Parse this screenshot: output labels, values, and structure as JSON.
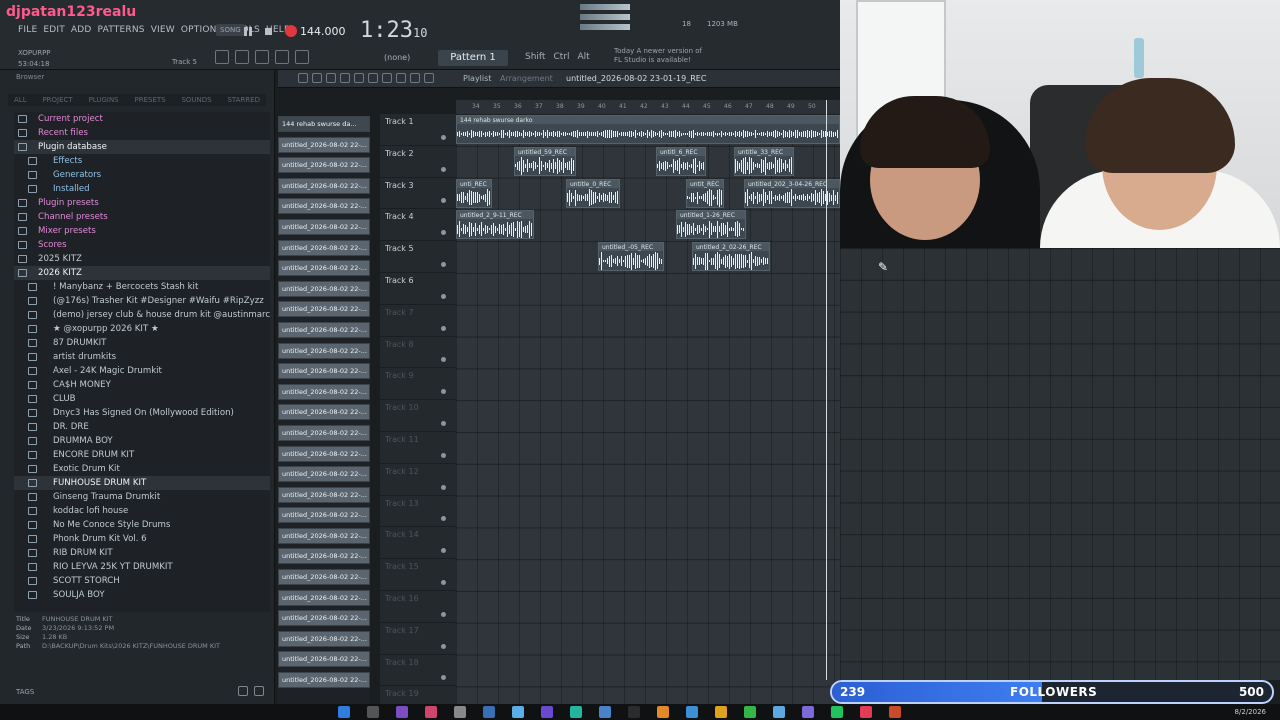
{
  "stream": {
    "username": "djpatan123realu"
  },
  "menu": [
    "FILE",
    "EDIT",
    "ADD",
    "PATTERNS",
    "VIEW",
    "OPTIONS",
    "TOOLS",
    "HELP"
  ],
  "transport": {
    "song_label": "SONG",
    "tempo": "144.000",
    "time": "1:23",
    "time_sub": "10",
    "cpu": "18",
    "ram": "1203 MB"
  },
  "user_tag": {
    "name": "XOPURPP",
    "elapsed": "53:04:18",
    "track": "Track 5"
  },
  "pattern": "Pattern 1",
  "snap": "(none)",
  "keys": [
    "Shift",
    "Ctrl",
    "Alt"
  ],
  "news": [
    "Today  A newer version of",
    "FL Studio is available!"
  ],
  "browser": {
    "title": "Browser",
    "tabs": [
      "ALL",
      "PROJECT",
      "PLUGINS",
      "PRESETS",
      "SOUNDS",
      "STARRED"
    ],
    "items": [
      {
        "label": "Current project",
        "kind": "pink"
      },
      {
        "label": "Recent files",
        "kind": "pink"
      },
      {
        "label": "Plugin database",
        "kind": "blue",
        "selected": true
      },
      {
        "label": "Effects",
        "kind": "blue",
        "level": 2
      },
      {
        "label": "Generators",
        "kind": "blue",
        "level": 2
      },
      {
        "label": "Installed",
        "kind": "blue",
        "level": 2
      },
      {
        "label": "Plugin presets",
        "kind": "pink"
      },
      {
        "label": "Channel presets",
        "kind": "pink"
      },
      {
        "label": "Mixer presets",
        "kind": "pink"
      },
      {
        "label": "Scores",
        "kind": "pink"
      },
      {
        "label": "2025 KITZ",
        "kind": "normal"
      },
      {
        "label": "2026 KITZ",
        "kind": "normal",
        "selected": true
      },
      {
        "label": "! Manybanz + Bercocets Stash kit",
        "kind": "normal",
        "level": 2
      },
      {
        "label": "(@176s) Trasher Kit #Designer #Waifu #RipZyzz",
        "kind": "normal",
        "level": 2
      },
      {
        "label": "(demo) jersey club & house drum kit @austinmarc",
        "kind": "normal",
        "level": 2
      },
      {
        "label": "★ @xopurpp 2026 KIT ★",
        "kind": "normal",
        "level": 2
      },
      {
        "label": "87 DRUMKIT",
        "kind": "normal",
        "level": 2
      },
      {
        "label": "artist drumkits",
        "kind": "normal",
        "level": 2
      },
      {
        "label": "Axel - 24K Magic Drumkit",
        "kind": "normal",
        "level": 2
      },
      {
        "label": "CA$H MONEY",
        "kind": "normal",
        "level": 2
      },
      {
        "label": "CLUB",
        "kind": "normal",
        "level": 2
      },
      {
        "label": "Dnyc3 Has Signed On (Mollywood Edition)",
        "kind": "normal",
        "level": 2
      },
      {
        "label": "DR. DRE",
        "kind": "normal",
        "level": 2
      },
      {
        "label": "DRUMMA BOY",
        "kind": "normal",
        "level": 2
      },
      {
        "label": "ENCORE DRUM KIT",
        "kind": "normal",
        "level": 2
      },
      {
        "label": "Exotic Drum Kit",
        "kind": "normal",
        "level": 2
      },
      {
        "label": "FUNHOUSE DRUM KIT",
        "kind": "normal",
        "level": 2,
        "selected": true
      },
      {
        "label": "Ginseng Trauma Drumkit",
        "kind": "normal",
        "level": 2
      },
      {
        "label": "koddac lofi house",
        "kind": "normal",
        "level": 2
      },
      {
        "label": "No Me Conoce Style Drums",
        "kind": "normal",
        "level": 2
      },
      {
        "label": "Phonk Drum Kit Vol. 6",
        "kind": "normal",
        "level": 2
      },
      {
        "label": "RIB DRUM KIT",
        "kind": "normal",
        "level": 2
      },
      {
        "label": "RIO LEYVA 25K YT DRUMKIT",
        "kind": "normal",
        "level": 2
      },
      {
        "label": "SCOTT STORCH",
        "kind": "normal",
        "level": 2
      },
      {
        "label": "SOULJA BOY",
        "kind": "normal",
        "level": 2
      }
    ],
    "info": {
      "title": "FUNHOUSE DRUM KIT",
      "date": "3/23/2026 9:13:52 PM",
      "size": "1.28 KB",
      "path": "D:\\BACKUP\\Drum Kits\\2026 KITZ\\FUNHOUSE DRUM KIT"
    },
    "tags_label": "TAGS"
  },
  "channels": [
    "144 rehab swurse da...",
    "untitled_2026-08-02 22-...",
    "untitled_2026-08-02 22-...",
    "untitled_2026-08-02 22-...",
    "untitled_2026-08-02 22-...",
    "untitled_2026-08-02 22-...",
    "untitled_2026-08-02 22-...",
    "untitled_2026-08-02 22-...",
    "untitled_2026-08-02 22-...",
    "untitled_2026-08-02 22-...",
    "untitled_2026-08-02 22-...",
    "untitled_2026-08-02 22-...",
    "untitled_2026-08-02 22-...",
    "untitled_2026-08-02 22-...",
    "untitled_2026-08-02 22-...",
    "untitled_2026-08-02 22-...",
    "untitled_2026-08-02 22-...",
    "untitled_2026-08-02 22-...",
    "untitled_2026-08-02 22-...",
    "untitled_2026-08-02 22-...",
    "untitled_2026-08-02 22-...",
    "untitled_2026-08-02 22-...",
    "untitled_2026-08-02 22-...",
    "untitled_2026-08-02 22-...",
    "untitled_2026-08-02 22-...",
    "untitled_2026-08-02 22-...",
    "untitled_2026-08-02 22-...",
    "untitled_2026-08-02 22-..."
  ],
  "playlist": {
    "title": "Playlist",
    "section": "Arrangement",
    "project_name": "untitled_2026-08-02 23-01-19_REC",
    "ruler": [
      "34",
      "35",
      "36",
      "37",
      "38",
      "39",
      "40",
      "41",
      "42",
      "43",
      "44",
      "45",
      "46",
      "47",
      "48",
      "49",
      "50"
    ],
    "tracks": [
      {
        "name": "Track 1",
        "active": true
      },
      {
        "name": "Track 2",
        "active": true
      },
      {
        "name": "Track 3",
        "active": true
      },
      {
        "name": "Track 4",
        "active": true
      },
      {
        "name": "Track 5",
        "active": true
      },
      {
        "name": "Track 6",
        "active": true
      },
      {
        "name": "Track 7",
        "active": false
      },
      {
        "name": "Track 8",
        "active": false
      },
      {
        "name": "Track 9",
        "active": false
      },
      {
        "name": "Track 10",
        "active": false
      },
      {
        "name": "Track 11",
        "active": false
      },
      {
        "name": "Track 12",
        "active": false
      },
      {
        "name": "Track 13",
        "active": false
      },
      {
        "name": "Track 14",
        "active": false
      },
      {
        "name": "Track 15",
        "active": false
      },
      {
        "name": "Track 16",
        "active": false
      },
      {
        "name": "Track 17",
        "active": false
      },
      {
        "name": "Track 18",
        "active": false
      },
      {
        "name": "Track 19",
        "active": false
      }
    ],
    "clips": [
      {
        "label": "144 rehab swurse darko"
      },
      {
        "label": "untitled_59_REC"
      },
      {
        "label": "untitl_6_REC"
      },
      {
        "label": "untitle_33_REC"
      },
      {
        "label": "unti_REC"
      },
      {
        "label": "untitle_0_REC"
      },
      {
        "label": "untit_REC"
      },
      {
        "label": "untitled_202_3-04-26_REC"
      },
      {
        "label": "untitled_2_9-11_REC"
      },
      {
        "label": "untitled_1-26_REC"
      },
      {
        "label": "untitled_-05_REC"
      },
      {
        "label": "untitled_2_02-26_REC"
      }
    ]
  },
  "followers": {
    "current": "239",
    "label": "FOLLOWERS",
    "goal": "500",
    "progress": 0.478
  },
  "taskbar": {
    "date": "8/2/2026"
  }
}
